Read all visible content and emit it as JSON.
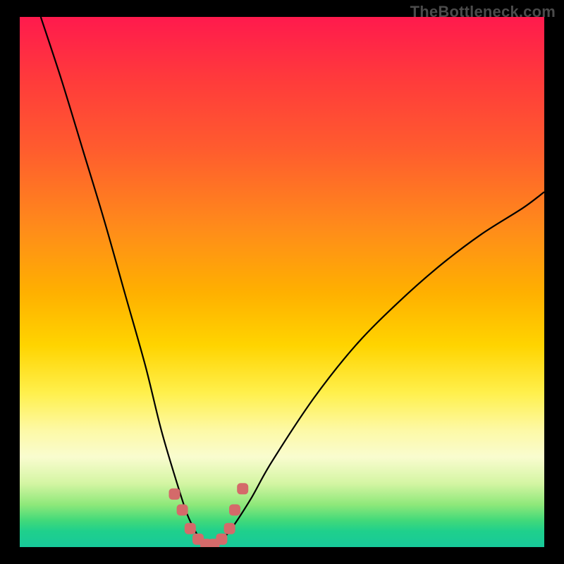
{
  "watermark": "TheBottleneck.com",
  "chart_data": {
    "type": "line",
    "title": "",
    "xlabel": "",
    "ylabel": "",
    "xlim": [
      0,
      100
    ],
    "ylim": [
      0,
      100
    ],
    "series": [
      {
        "name": "bottleneck-curve",
        "x": [
          4,
          8,
          12,
          16,
          20,
          24,
          27,
          30,
          32,
          34,
          35,
          36,
          37,
          40,
          44,
          48,
          56,
          64,
          72,
          80,
          88,
          96,
          100
        ],
        "y": [
          100,
          88,
          75,
          62,
          48,
          34,
          22,
          12,
          6,
          2,
          0,
          0,
          0,
          3,
          9,
          16,
          28,
          38,
          46,
          53,
          59,
          64,
          67
        ]
      }
    ],
    "markers": {
      "name": "highlight-dots",
      "x": [
        29.5,
        31,
        32.5,
        34,
        35.5,
        37,
        38.5,
        40,
        41,
        42.5
      ],
      "y": [
        10,
        7,
        3.5,
        1.5,
        0.5,
        0.5,
        1.5,
        3.5,
        7,
        11
      ]
    },
    "background": {
      "style": "vertical-gradient",
      "top_color": "#ff1a4d",
      "bottom_color": "#17c99a"
    }
  }
}
